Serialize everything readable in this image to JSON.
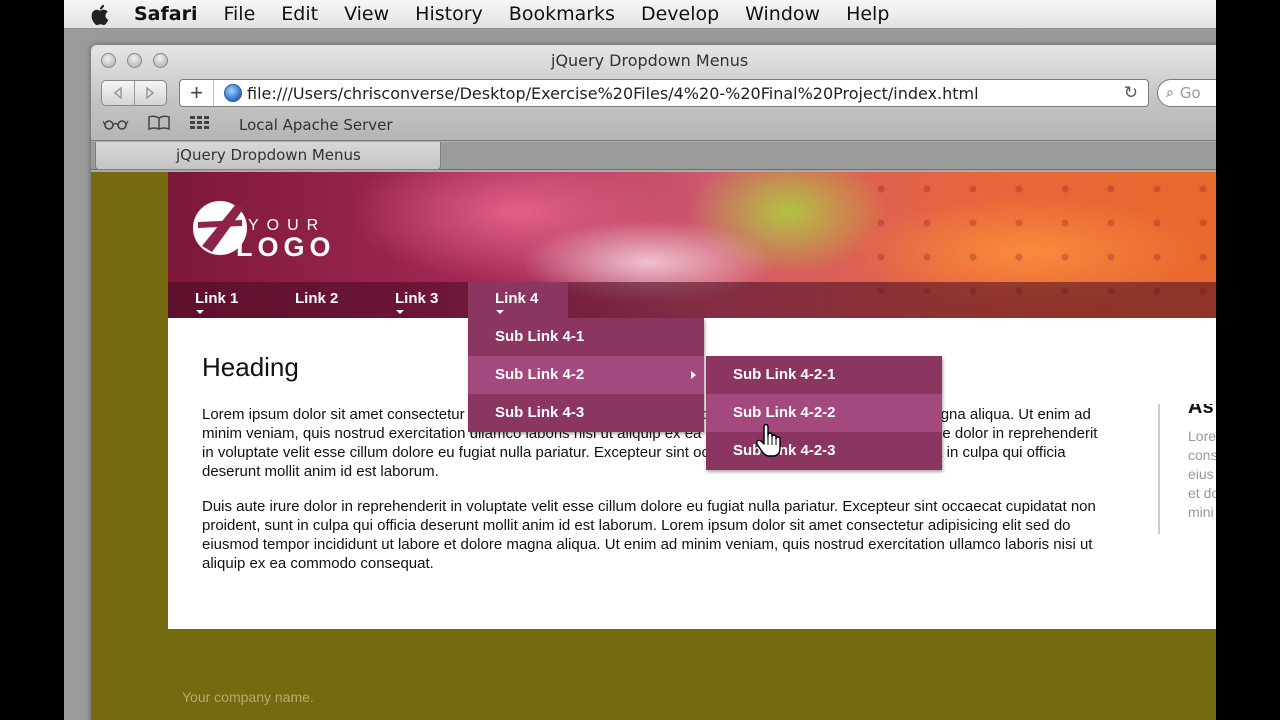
{
  "menubar": {
    "app": "Safari",
    "items": [
      "File",
      "Edit",
      "View",
      "History",
      "Bookmarks",
      "Develop",
      "Window",
      "Help"
    ]
  },
  "browser": {
    "window_title": "jQuery Dropdown Menus",
    "url": "file:///Users/chrisconverse/Desktop/Exercise%20Files/4%20-%20Final%20Project/index.html",
    "search_placeholder": "Go",
    "bookmark": "Local Apache Server",
    "tab_title": "jQuery Dropdown Menus",
    "icons": [
      "back-icon",
      "forward-icon",
      "add-icon",
      "globe-icon",
      "reload-icon",
      "search-icon",
      "reading-list-icon",
      "bookmarks-book-icon",
      "top-sites-grid-icon"
    ]
  },
  "site": {
    "logo": {
      "top": "YOUR",
      "bottom": "LOGO"
    },
    "nav": [
      "Link 1",
      "Link 2",
      "Link 3",
      "Link 4"
    ],
    "submenu": [
      "Sub Link 4-1",
      "Sub Link 4-2",
      "Sub Link 4-3"
    ],
    "subsubmenu": [
      "Sub Link 4-2-1",
      "Sub Link 4-2-2",
      "Sub Link 4-2-3"
    ],
    "heading": "Heading",
    "paragraphs": [
      "Lorem ipsum dolor sit amet consectetur adipisicing elit sed do eiusmod tempor incididunt ut labore et dolore magna aliqua. Ut enim ad minim veniam, quis nostrud exercitation ullamco laboris nisi ut aliquip ex ea commodo consequat. Duis aute irure dolor in reprehenderit in voluptate velit esse cillum dolore eu fugiat nulla pariatur. Excepteur sint occaecat cupidatat non proident, sunt in culpa qui officia deserunt mollit anim id est laborum.",
      "Duis aute irure dolor in reprehenderit in voluptate velit esse cillum dolore eu fugiat nulla pariatur. Excepteur sint occaecat cupidatat non proident, sunt in culpa qui officia deserunt mollit anim id est laborum. Lorem ipsum dolor sit amet consectetur adipisicing elit sed do eiusmod tempor incididunt ut labore et dolore magna aliqua. Ut enim ad minim veniam, quis nostrud exercitation ullamco laboris nisi ut aliquip ex ea commodo consequat."
    ],
    "aside_title": "As",
    "aside_lines": [
      "Lore",
      "cons",
      "eius",
      "et do",
      "mini"
    ],
    "footer": "Your company name."
  },
  "colors": {
    "page_bg": "#756a10",
    "menu": "#8a3661",
    "menu_highlight": "#a3497e"
  }
}
